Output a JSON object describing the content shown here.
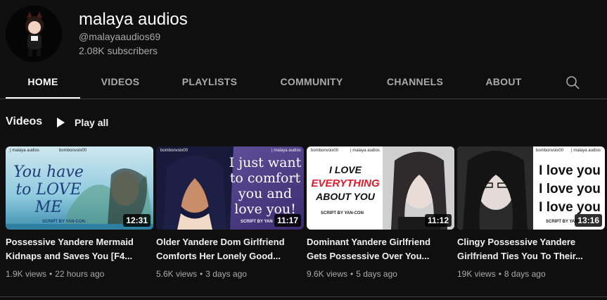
{
  "channel": {
    "name": "malaya audios",
    "handle": "@malayaaudios69",
    "subscribers": "2.08K subscribers"
  },
  "tabs": [
    {
      "label": "HOME",
      "active": true
    },
    {
      "label": "VIDEOS",
      "active": false
    },
    {
      "label": "PLAYLISTS",
      "active": false
    },
    {
      "label": "COMMUNITY",
      "active": false
    },
    {
      "label": "CHANNELS",
      "active": false
    },
    {
      "label": "ABOUT",
      "active": false
    }
  ],
  "search_icon": "search-icon",
  "section": {
    "title": "Videos",
    "play_all": "Play all"
  },
  "videos": [
    {
      "title": "Possessive Yandere Mermaid\nKidnaps and Saves You [F4...",
      "duration": "12:31",
      "views": "1.9K views",
      "age": "22 hours ago",
      "thumb_text": "You have to LOVE ME",
      "thumb_tag_left": "| malaya audios",
      "thumb_tag_right": "bombonvoix00",
      "thumb_credit": "SCRIPT BY YAN-CON"
    },
    {
      "title": "Older Yandere Dom Girlfriend\nComforts Her Lonely Good...",
      "duration": "11:17",
      "views": "5.6K views",
      "age": "3 days ago",
      "thumb_text": "I just want to comfort you and love you!",
      "thumb_tag_left": "bombonvoix00",
      "thumb_tag_right": "| malaya audios",
      "thumb_credit": "SCRIPT BY YAN"
    },
    {
      "title": "Dominant Yandere Girlfriend\nGets Possessive Over You...",
      "duration": "11:12",
      "views": "9.6K views",
      "age": "5 days ago",
      "thumb_text_1": "I LOVE",
      "thumb_text_2": "EVERYTHING",
      "thumb_text_3": "ABOUT YOU",
      "thumb_tag_left": "bombonvoix00",
      "thumb_tag_right": "| malaya audios",
      "thumb_credit": "SCRIPT BY YAN-CON"
    },
    {
      "title": "Clingy Possessive Yandere\nGirlfriend Ties You To Their...",
      "duration": "13:16",
      "views": "19K views",
      "age": "8 days ago",
      "thumb_text_1": "I love you",
      "thumb_text_2": "I love you",
      "thumb_text_3": "I love you",
      "thumb_tag_left": "bombonvoix00",
      "thumb_tag_right": "| malaya audios",
      "thumb_credit": "SCRIPT BY YAN-CON"
    }
  ]
}
